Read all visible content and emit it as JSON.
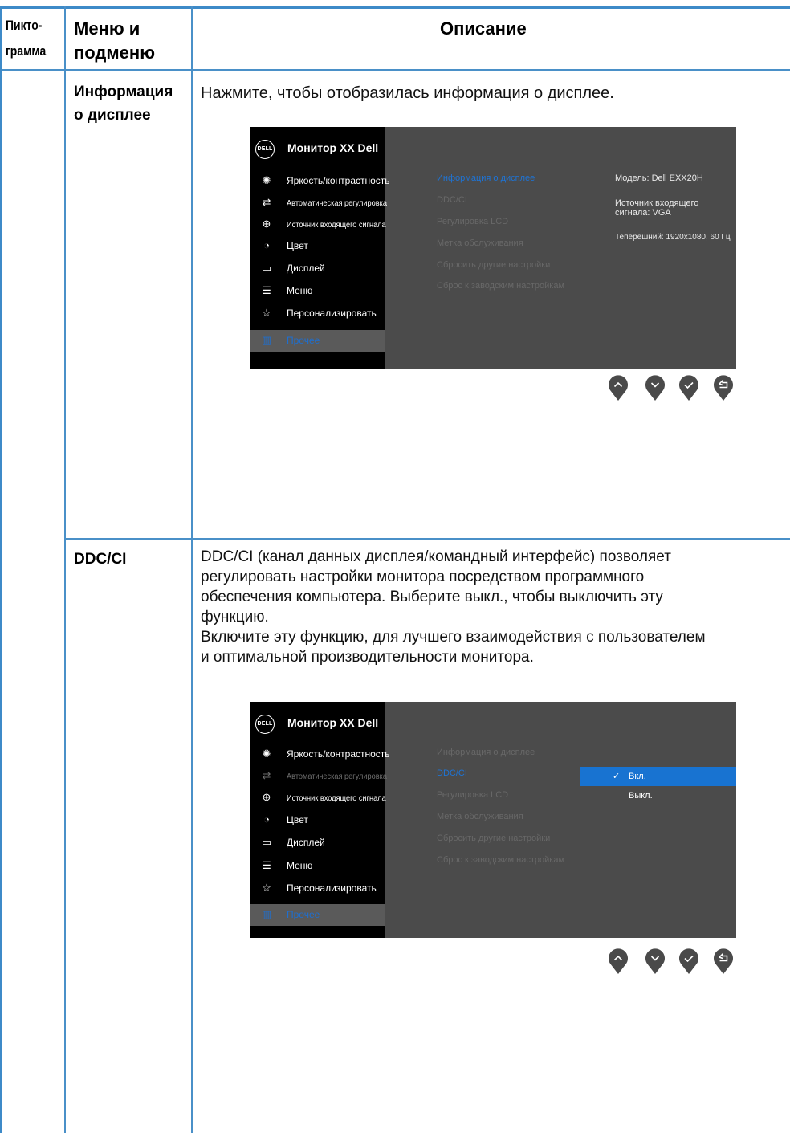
{
  "table": {
    "headers": {
      "icon_col": [
        "Пикто-",
        "грамма"
      ],
      "menu_col": [
        "Меню и",
        "подменю"
      ],
      "desc_col": "Описание"
    },
    "rows": [
      {
        "title": [
          "Информация",
          "о дисплее"
        ],
        "description": [
          "Нажмите, чтобы отобразилась информация о дисплее."
        ]
      },
      {
        "title": [
          "DDC/CI"
        ],
        "description": [
          "DDC/CI (канал данных дисплея/командный интерфейс) позволяет",
          "регулировать настройки монитора посредством программного",
          "обеспечения компьютера. Выберите выкл., чтобы выключить эту",
          "функцию.",
          "Включите эту функцию, для лучшего взаимодействия с пользователем",
          "и оптимальной производительности монитора."
        ]
      }
    ]
  },
  "osd": {
    "logo_text": "DELL",
    "title": "Монитор XX Dell",
    "menu": [
      {
        "label": "Яркость/контрастность",
        "icon": "brightness-icon"
      },
      {
        "label": "Автоматическая регулировка",
        "icon": "auto-adjust-icon"
      },
      {
        "label": "Источник входящего сигнала",
        "icon": "input-source-icon"
      },
      {
        "label": "Цвет",
        "icon": "color-icon"
      },
      {
        "label": "Дисплей",
        "icon": "display-icon"
      },
      {
        "label": "Меню",
        "icon": "menu-icon"
      },
      {
        "label": "Персонализировать",
        "icon": "star-icon"
      },
      {
        "label": "Прочее",
        "icon": "others-icon"
      }
    ],
    "submenu": [
      "Информация о дисплее",
      "DDC/CI",
      "Регулировка LCD",
      "Метка обслуживания",
      "Сбросить другие настройки",
      "Сброс к заводским настройкам"
    ],
    "display_info": {
      "model": "Модель: Dell EXX20H",
      "input_line1": "Источник входящего",
      "input_line2": "сигнала: VGA",
      "resolution": "Теперешний: 1920x1080, 60 Гц"
    },
    "ddc_options": {
      "on": "Вкл.",
      "off": "Выкл."
    },
    "buttons": [
      "up-icon",
      "down-icon",
      "check-icon",
      "back-icon"
    ]
  },
  "colors": {
    "table_border": "#4a90c8",
    "osd_accent": "#1873d1",
    "osd_bg": "#4b4b4b",
    "osd_sidebar": "#000000"
  }
}
